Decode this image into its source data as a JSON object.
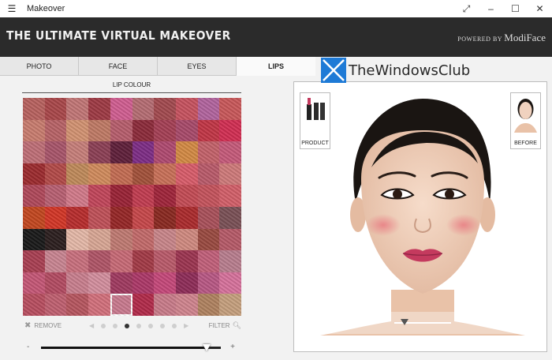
{
  "window": {
    "title": "Makeover",
    "menu_icon": "hamburger-icon",
    "controls": [
      "expand-icon",
      "minimize-icon",
      "maximize-icon",
      "close-icon"
    ]
  },
  "banner": {
    "title": "THE ULTIMATE VIRTUAL MAKEOVER",
    "powered_by": "POWERED BY",
    "vendor": "ModiFace"
  },
  "tabs": [
    {
      "label": "PHOTO",
      "active": false
    },
    {
      "label": "FACE",
      "active": false
    },
    {
      "label": "EYES",
      "active": false
    },
    {
      "label": "LIPS",
      "active": true
    }
  ],
  "section": {
    "label": "LIP COLOUR"
  },
  "palette": {
    "selected_index": 94,
    "colors": [
      "#b8625f",
      "#a9474a",
      "#c27676",
      "#9e3a44",
      "#d15e91",
      "#b56d73",
      "#a34a4f",
      "#c7525f",
      "#b2649e",
      "#c9585a",
      "#c97d6f",
      "#b86367",
      "#d39372",
      "#c07a65",
      "#b75d6c",
      "#8c2a3a",
      "#a53f55",
      "#a84a6a",
      "#c23545",
      "#d22e52",
      "#bf6f77",
      "#a8556a",
      "#c77f7a",
      "#8c3f55",
      "#5f1f3a",
      "#7e2d86",
      "#b04a70",
      "#d48a44",
      "#c4626a",
      "#c65a7a",
      "#9c2a2e",
      "#b34a48",
      "#c08a5a",
      "#d18b5c",
      "#c46c52",
      "#a3513a",
      "#c97058",
      "#d95c6a",
      "#ba5a6a",
      "#cf7a7a",
      "#b0485a",
      "#b86072",
      "#d27a8a",
      "#c2455a",
      "#9a2235",
      "#c23c50",
      "#a0243a",
      "#c44b55",
      "#c5535c",
      "#d35f69",
      "#c3471f",
      "#d43626",
      "#b82c2c",
      "#c05058",
      "#962626",
      "#c7474a",
      "#8a2820",
      "#ab2a2c",
      "#a9505a",
      "#7a5056",
      "#191919",
      "#2b1e1e",
      "#e5b9a8",
      "#d9a795",
      "#c07a72",
      "#c36a6a",
      "#c9868a",
      "#d08a80",
      "#9a4a40",
      "#b65a68",
      "#a93f52",
      "#c98592",
      "#c9707e",
      "#b05567",
      "#c86a76",
      "#a33a46",
      "#ba5a6a",
      "#9c3450",
      "#c2607a",
      "#b97e8e",
      "#c55776",
      "#b34b62",
      "#c97f8e",
      "#d48f9e",
      "#a03a60",
      "#ad3868",
      "#c6487a",
      "#8e2c58",
      "#b95884",
      "#d7729c",
      "#b84e60",
      "#c06070",
      "#b7565f",
      "#d3707c",
      "#c97a8f",
      "#b22a4a",
      "#c97c8a",
      "#d0848e",
      "#b08260",
      "#c6a07e"
    ]
  },
  "pager": {
    "remove_label": "REMOVE",
    "filter_label": "FILTER",
    "pages": 7,
    "current_page": 3
  },
  "intensity": {
    "minus": "-",
    "plus": "+",
    "value": 0.92
  },
  "preview": {
    "product_label": "PRODUCT",
    "before_label": "BEFORE",
    "tools": [
      "sun-icon",
      "undo-icon",
      "zoom-slider",
      "cancel-icon",
      "wand-icon"
    ],
    "zoom_value": 0.18
  },
  "watermark": {
    "text": "TheWindowsClub"
  },
  "colors": {
    "banner_bg": "#2b2b2b",
    "lip": "#c43a5e",
    "skin": "#f2d1bd"
  }
}
